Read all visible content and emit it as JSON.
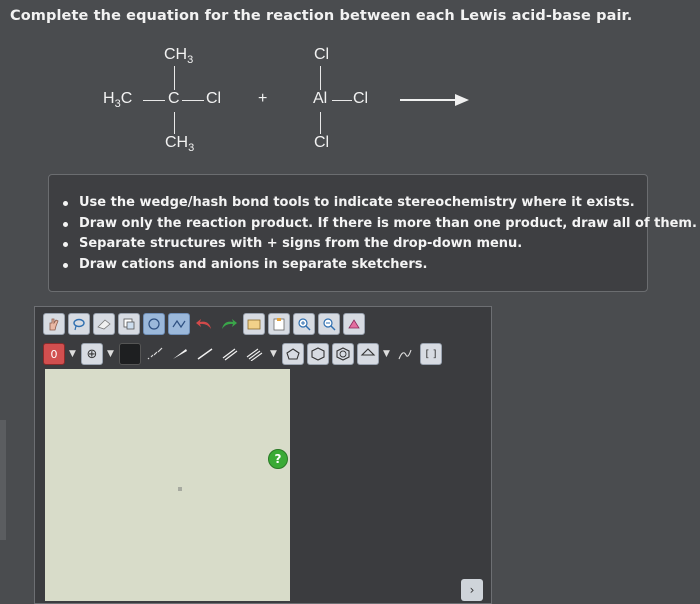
{
  "question": "Complete the equation for the reaction between each Lewis acid-base pair.",
  "reaction": {
    "reactant1": {
      "top": "CH",
      "top_sub": "3",
      "left": "H",
      "left_sub": "3",
      "left_c": "C",
      "center": "C",
      "right": "Cl",
      "bottom": "CH",
      "bottom_sub": "3"
    },
    "plus": "+",
    "reactant2": {
      "top": "Cl",
      "center": "Al",
      "right": "Cl",
      "bottom": "Cl"
    }
  },
  "instructions": [
    "Use the wedge/hash bond tools to indicate stereochemistry where it exists.",
    "Draw only the reaction product. If there is more than one product, draw all of them.",
    "Separate structures with + signs from the drop-down menu.",
    "Draw cations and anions in separate sketchers."
  ],
  "sketcher": {
    "charge_label": "0",
    "add_label": "⊕",
    "help_label": "?",
    "expand_label": "›"
  }
}
